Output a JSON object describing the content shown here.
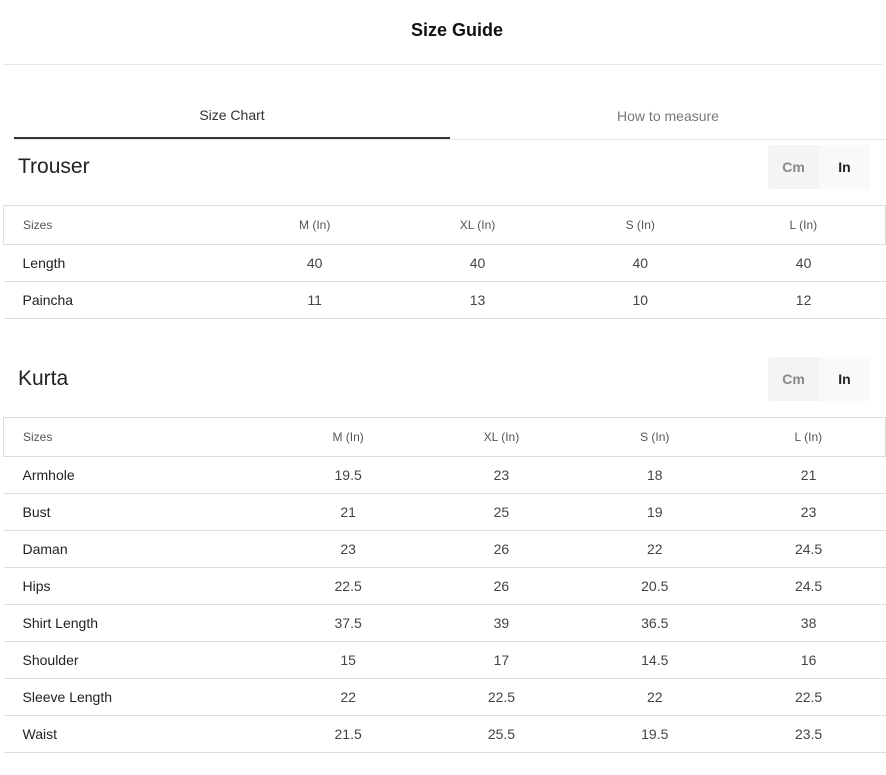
{
  "header": {
    "title": "Size Guide"
  },
  "tabs": [
    {
      "label": "Size Chart",
      "active": true
    },
    {
      "label": "How to measure",
      "active": false
    }
  ],
  "unit_toggle": {
    "cm_label": "Cm",
    "in_label": "In",
    "selected": "In"
  },
  "trouser": {
    "title": "Trouser",
    "columns": [
      "Sizes",
      "M (In)",
      "XL (In)",
      "S (In)",
      "L (In)"
    ],
    "rows": [
      [
        "Length",
        "40",
        "40",
        "40",
        "40"
      ],
      [
        "Paincha",
        "11",
        "13",
        "10",
        "12"
      ]
    ]
  },
  "kurta": {
    "title": "Kurta",
    "columns": [
      "Sizes",
      "M (In)",
      "XL (In)",
      "S (In)",
      "L (In)"
    ],
    "rows": [
      [
        "Armhole",
        "19.5",
        "23",
        "18",
        "21"
      ],
      [
        "Bust",
        "21",
        "25",
        "19",
        "23"
      ],
      [
        "Daman",
        "23",
        "26",
        "22",
        "24.5"
      ],
      [
        "Hips",
        "22.5",
        "26",
        "20.5",
        "24.5"
      ],
      [
        "Shirt Length",
        "37.5",
        "39",
        "36.5",
        "38"
      ],
      [
        "Shoulder",
        "15",
        "17",
        "14.5",
        "16"
      ],
      [
        "Sleeve Length",
        "22",
        "22.5",
        "22",
        "22.5"
      ],
      [
        "Waist",
        "21.5",
        "25.5",
        "19.5",
        "23.5"
      ]
    ]
  }
}
